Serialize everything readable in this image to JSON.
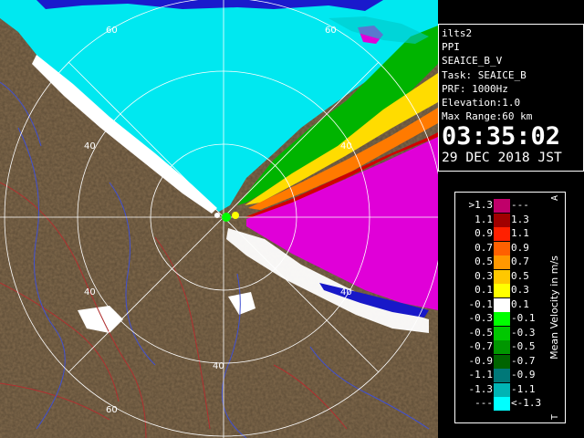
{
  "info": {
    "site": "ilts2",
    "mode": "PPI",
    "product": "SEAICE_B_V",
    "task": "Task: SEAICE_B",
    "prf": "PRF: 1000Hz",
    "elevation": "Elevation:1.0",
    "max_range": "Max Range:60 km",
    "time": "03:35:02",
    "date": "29 DEC 2018 JST"
  },
  "ring_labels": [
    "60",
    "60",
    "40",
    "40",
    "40",
    "40",
    "40",
    "60"
  ],
  "legend": {
    "title": "Mean Velocity in m/s",
    "corner_top": "A",
    "corner_bottom": "T",
    "rows": [
      {
        "left": ">1.3",
        "right": "---",
        "color": "#c0006a"
      },
      {
        "left": "1.1",
        "right": "1.3",
        "color": "#a00000"
      },
      {
        "left": "0.9",
        "right": "1.1",
        "color": "#ff2000"
      },
      {
        "left": "0.7",
        "right": "0.9",
        "color": "#ff6000"
      },
      {
        "left": "0.5",
        "right": "0.7",
        "color": "#ff9800"
      },
      {
        "left": "0.3",
        "right": "0.5",
        "color": "#ffc800"
      },
      {
        "left": "0.1",
        "right": "0.3",
        "color": "#ffff00"
      },
      {
        "left": "-0.1",
        "right": "0.1",
        "color": "#ffffff"
      },
      {
        "left": "-0.3",
        "right": "-0.1",
        "color": "#00ff00"
      },
      {
        "left": "-0.5",
        "right": "-0.3",
        "color": "#00c800"
      },
      {
        "left": "-0.7",
        "right": "-0.5",
        "color": "#009600"
      },
      {
        "left": "-0.9",
        "right": "-0.7",
        "color": "#006400"
      },
      {
        "left": "-1.1",
        "right": "-0.9",
        "color": "#007878"
      },
      {
        "left": "-1.3",
        "right": "-1.1",
        "color": "#00b4b4"
      },
      {
        "left": "---",
        "right": "<-1.3",
        "color": "#00ffff"
      }
    ]
  },
  "colors": {
    "land": "#7a6448",
    "sea_north": "#00e8f0",
    "sea_east": "#e000d8",
    "clutter_white": "#ffffff",
    "coast_blue": "#1818c8",
    "range_ring": "#ffffff",
    "map_line_red": "#b03030",
    "map_line_blue": "#4050d0"
  }
}
